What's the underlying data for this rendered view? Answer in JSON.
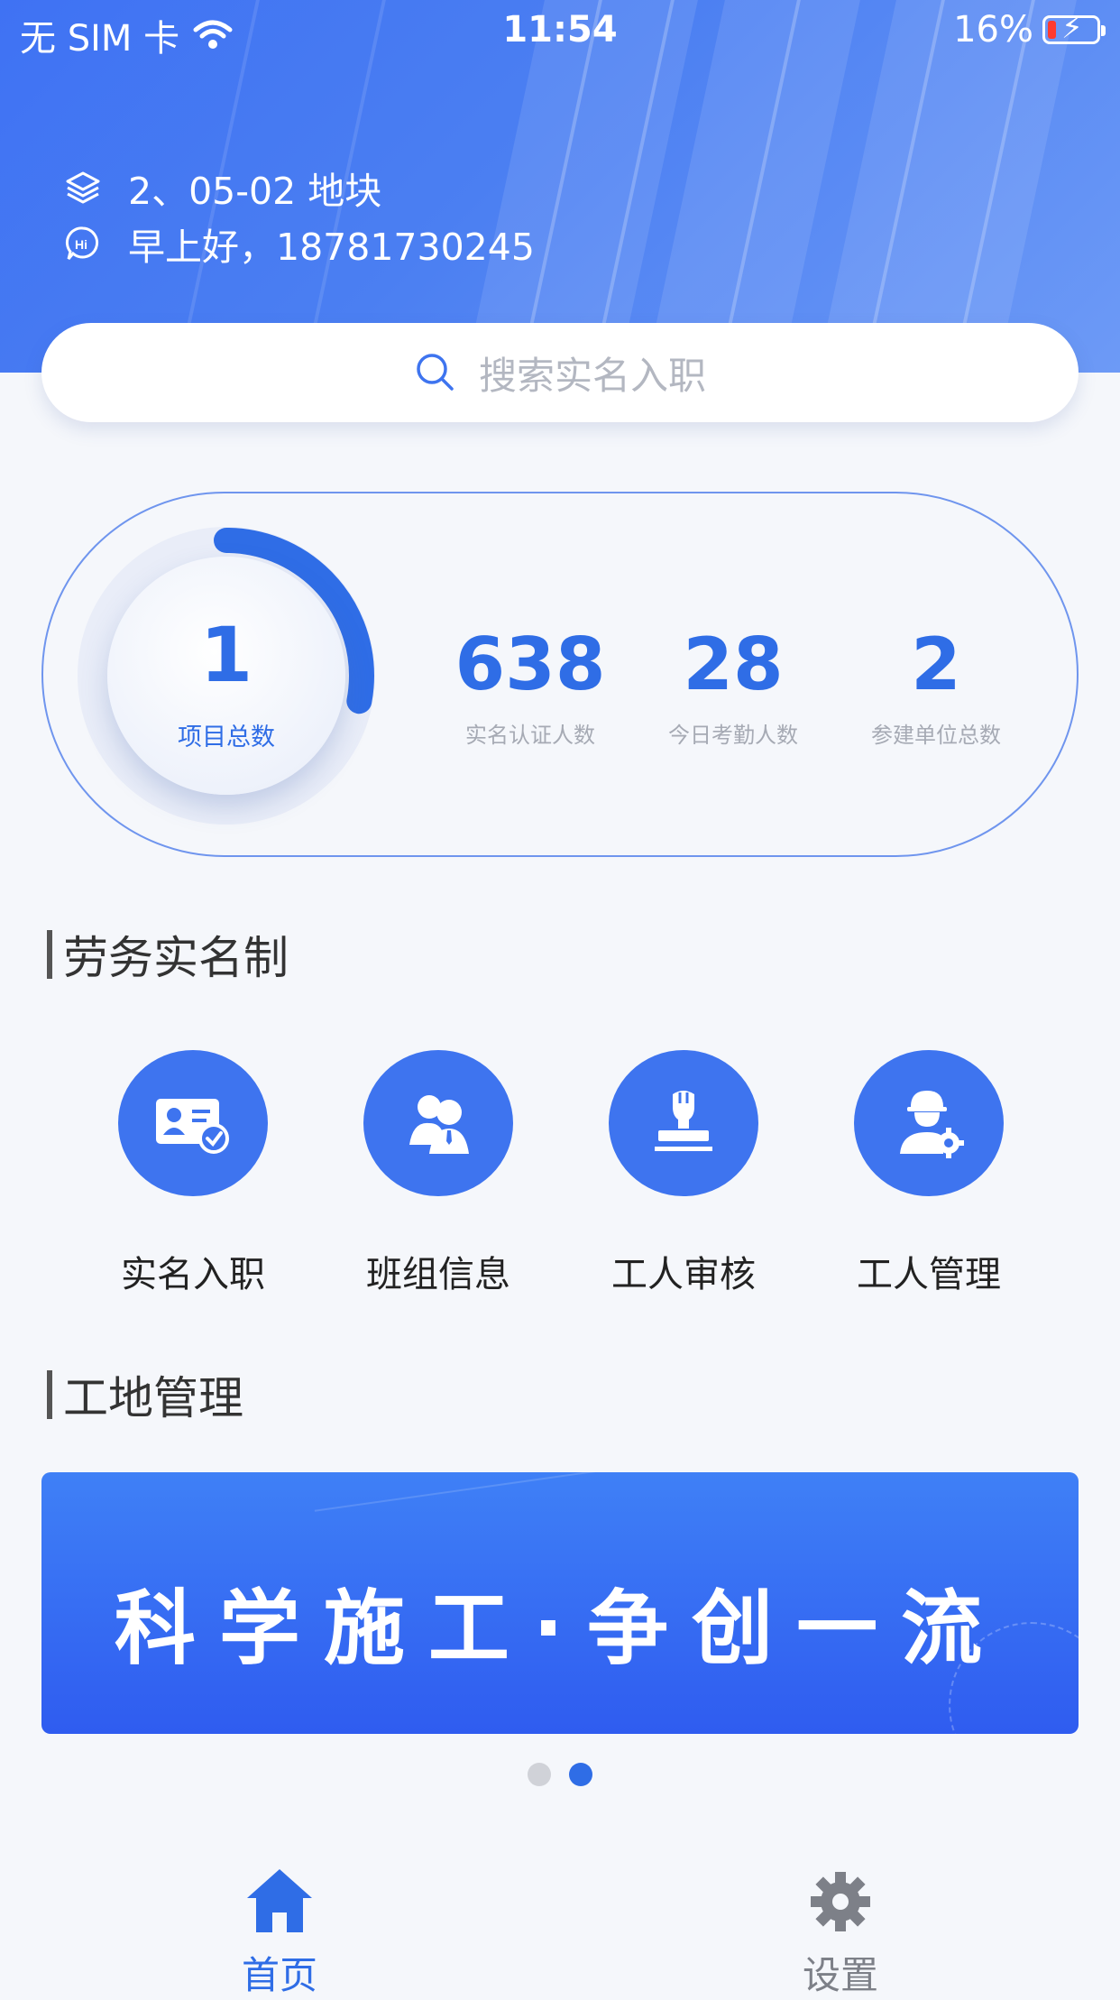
{
  "status_bar": {
    "carrier": "无 SIM 卡",
    "time": "11:54",
    "battery": "16%"
  },
  "header": {
    "site_name": "2、05-02 地块",
    "greeting": "早上好，18781730245",
    "icons": [
      "layers-icon",
      "hi-chat-icon"
    ]
  },
  "search": {
    "placeholder": "搜索实名入职"
  },
  "stats": {
    "project_total": {
      "value": "1",
      "label": "项目总数",
      "ring_progress": 0.28
    },
    "items": [
      {
        "value": "638",
        "label": "实名认证人数"
      },
      {
        "value": "28",
        "label": "今日考勤人数"
      },
      {
        "value": "2",
        "label": "参建单位总数"
      }
    ]
  },
  "section_labor": {
    "title": "劳务实名制",
    "items": [
      {
        "label": "实名入职",
        "icon": "id-card-check-icon"
      },
      {
        "label": "班组信息",
        "icon": "group-users-icon"
      },
      {
        "label": "工人审核",
        "icon": "stamp-icon"
      },
      {
        "label": "工人管理",
        "icon": "worker-gear-icon"
      }
    ]
  },
  "section_site": {
    "title": "工地管理",
    "banner_text": "科学施工·争创一流",
    "carousel": {
      "count": 2,
      "active_index": 1
    }
  },
  "tabbar": {
    "items": [
      {
        "label": "首页",
        "icon": "home-icon",
        "active": true
      },
      {
        "label": "设置",
        "icon": "settings-gear-icon",
        "active": false
      }
    ]
  },
  "colors": {
    "primary": "#2f6de6",
    "header_blue": "#3f72f3",
    "muted_text": "#a6aab4",
    "inactive_tab": "#7d8088"
  }
}
